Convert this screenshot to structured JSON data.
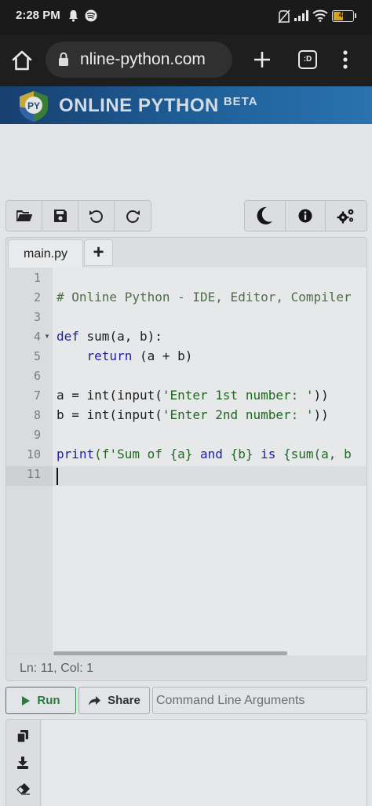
{
  "status_bar": {
    "time": "2:28 PM",
    "icons": [
      "bell-icon",
      "spotify-icon",
      "no-sim-icon",
      "signal-icon",
      "wifi-icon"
    ],
    "battery_level": "45"
  },
  "browser": {
    "url": "nline-python.com",
    "tab_switcher_label": ":D"
  },
  "site": {
    "logo_text": "PY",
    "title": "ONLINE PYTHON",
    "badge": "BETA"
  },
  "toolbar": {
    "left_buttons": [
      "open-folder-icon",
      "save-icon",
      "undo-icon",
      "redo-icon"
    ],
    "right_buttons": [
      "dark-mode-moon-icon",
      "info-icon",
      "settings-gears-icon"
    ]
  },
  "editor": {
    "tab_label": "main.py",
    "add_tab_label": "+",
    "line_numbers": [
      "1",
      "2",
      "3",
      "4",
      "5",
      "6",
      "7",
      "8",
      "9",
      "10",
      "11"
    ],
    "code": {
      "line2": "# Online Python - IDE, Editor, Compiler",
      "line4_kw": "def",
      "line4_rest": " sum(a, b):",
      "line5_indent": "    ",
      "line5_kw": "return",
      "line5_rest": " (a + b)",
      "line7_pre": "a = int(input(",
      "line7_str": "'Enter 1st number: '",
      "line7_post": "))",
      "line8_pre": "b = int(input(",
      "line8_str": "'Enter 2nd number: '",
      "line8_post": "))",
      "line10_kw": "print",
      "line10_pre": "(f'Sum of {a} ",
      "line10_and": "and",
      "line10_mid": " {b} ",
      "line10_is": "is",
      "line10_post": " {sum(a, b"
    },
    "status": "Ln: 11,  Col: 1"
  },
  "actions": {
    "run_label": "Run",
    "share_label": "Share",
    "args_placeholder": "Command Line Arguments"
  },
  "output_tools": [
    "copy-icon",
    "download-icon",
    "eraser-icon"
  ],
  "colors": {
    "run_green": "#2a7a3f",
    "header_blue": "#1e5e96",
    "keyword_blue": "#1d1ea0",
    "string_green": "#1d6a1d"
  }
}
